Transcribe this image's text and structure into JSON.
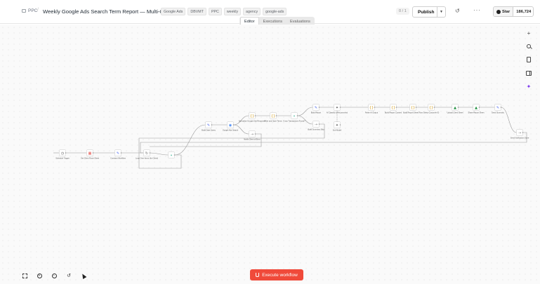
{
  "header": {
    "breadcrumb": "PPC",
    "breadcrumb_separator": "/",
    "title": "Weekly Google Ads Search Term Report — Multi-Client",
    "tags": [
      "Google Ads",
      "DBVMT",
      "PPC",
      "weekly",
      "agency",
      "google-ads"
    ],
    "version_counter": "0 / 1",
    "publish_label": "Publish",
    "star_label": "Star",
    "star_count": "186,724"
  },
  "view_tabs": [
    "Editor",
    "Executions",
    "Evaluations"
  ],
  "active_view_tab": "Editor",
  "execute_label": "Execute workflow",
  "colors": {
    "accent": "#f04a3a",
    "node_border": "#c9c9c9",
    "edge": "#9b9b9b",
    "google_green": "#1e8e3e"
  },
  "workflow": {
    "nodes": [
      {
        "id": "schedule",
        "label": "Schedule Trigger",
        "icon": "clock-icon"
      },
      {
        "id": "sheet",
        "label": "Get Client Rows Sheet",
        "icon": "sheet-icon"
      },
      {
        "id": "config",
        "label": "Constant Workflow",
        "icon": "edit-icon"
      },
      {
        "id": "loop",
        "label": "Loop Over Items (for Client)",
        "icon": "loop-icon"
      },
      {
        "id": "switch",
        "label": "",
        "icon": "switch-icon"
      },
      {
        "id": "setdate",
        "label": "Build Date Query",
        "icon": "edit-icon"
      },
      {
        "id": "gads",
        "label": "Google Ads Search",
        "icon": "gads-icon"
      },
      {
        "id": "normalize",
        "label": "Normalize Google Ads Response",
        "icon": "code-icon"
      },
      {
        "id": "noop1",
        "label": "Notify Client of Error",
        "icon": "arrow-icon"
      },
      {
        "id": "filter",
        "label": "Filter and Save Terms",
        "icon": "code-icon"
      },
      {
        "id": "any",
        "label": "If any Transactions Found?",
        "icon": "if-icon"
      },
      {
        "id": "build",
        "label": "Build Report",
        "icon": "edit-icon"
      },
      {
        "id": "noop2",
        "label": "Build Summary Skip",
        "icon": "arrow-icon"
      },
      {
        "id": "aggregate",
        "label": "AI Classify & Recommend",
        "icon": "ai-icon"
      },
      {
        "id": "model",
        "label": "Sub Model",
        "icon": "ai-icon"
      },
      {
        "id": "parse",
        "label": "Parse AI Output",
        "icon": "code-icon"
      },
      {
        "id": "buildsheet",
        "label": "Build Report Content",
        "icon": "code-icon"
      },
      {
        "id": "buildtab",
        "label": "Build Report Sheet Row",
        "icon": "code-icon"
      },
      {
        "id": "pick",
        "label": "Select Customer ID",
        "icon": "code-icon"
      },
      {
        "id": "upload",
        "label": "Upload Client Sheet",
        "icon": "drive-icon"
      },
      {
        "id": "share",
        "label": "Share Report Sheet",
        "icon": "drive-icon"
      },
      {
        "id": "send",
        "label": "Send Summary",
        "icon": "edit-icon"
      },
      {
        "id": "noop3",
        "label": "Send Notification Done",
        "icon": "arrow-icon"
      }
    ]
  }
}
